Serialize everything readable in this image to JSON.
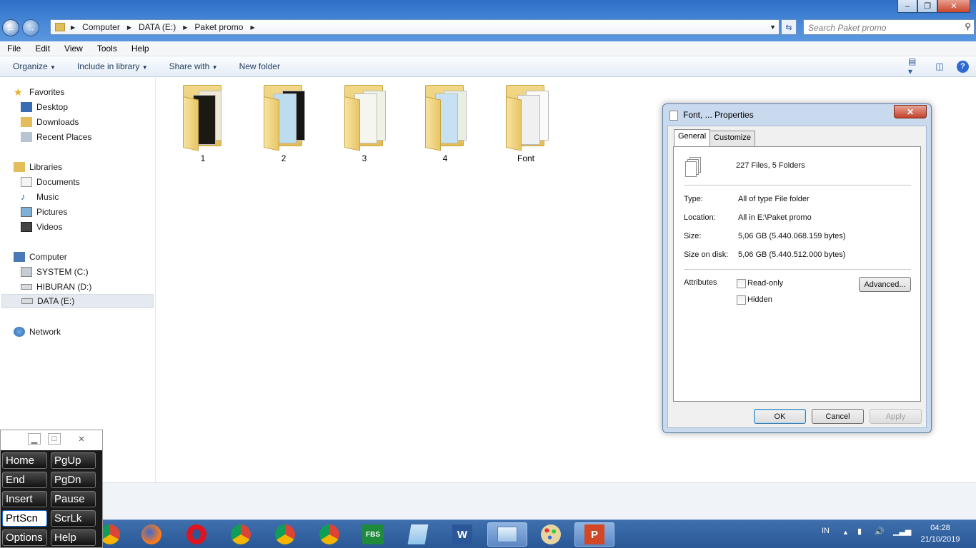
{
  "window": {
    "address": {
      "crumbs": [
        "Computer",
        "DATA (E:)",
        "Paket promo"
      ]
    },
    "search_placeholder": "Search Paket promo",
    "controls": {
      "minimize": "‒",
      "maximize": "❐",
      "close": "✕"
    }
  },
  "menu": [
    "File",
    "Edit",
    "View",
    "Tools",
    "Help"
  ],
  "toolbar": {
    "organize": "Organize",
    "include": "Include in library",
    "share": "Share with",
    "new_folder": "New folder"
  },
  "nav": {
    "favorites": "Favorites",
    "desktop": "Desktop",
    "downloads": "Downloads",
    "recent": "Recent Places",
    "libraries": "Libraries",
    "documents": "Documents",
    "music": "Music",
    "pictures": "Pictures",
    "videos": "Videos",
    "computer": "Computer",
    "system_c": "SYSTEM (C:)",
    "hiburan_d": "HIBURAN (D:)",
    "data_e": "DATA (E:)",
    "network": "Network"
  },
  "folders": [
    "1",
    "2",
    "3",
    "4",
    "Font"
  ],
  "dialog": {
    "title": "Font, ... Properties",
    "close": "✕",
    "tabs": {
      "general": "General",
      "customize": "Customize"
    },
    "summary": "227 Files, 5 Folders",
    "type_label": "Type:",
    "type_value": "All of type File folder",
    "location_label": "Location:",
    "location_value": "All in E:\\Paket promo",
    "size_label": "Size:",
    "size_value": "5,06 GB (5.440.068.159 bytes)",
    "disk_label": "Size on disk:",
    "disk_value": "5,06 GB (5.440.512.000 bytes)",
    "attributes_label": "Attributes",
    "readonly": "Read-only",
    "hidden": "Hidden",
    "advanced": "Advanced...",
    "ok": "OK",
    "cancel": "Cancel",
    "apply": "Apply"
  },
  "osk": {
    "keys": [
      "Home",
      "PgUp",
      "End",
      "PgDn",
      "Insert",
      "Pause",
      "PrtScn",
      "ScrLk",
      "Options",
      "Help"
    ]
  },
  "tray": {
    "lang": "IN",
    "time": "04:28",
    "date": "21/10/2019"
  },
  "taskbar": {
    "fbs": "FBS"
  },
  "colors": {
    "accent": "#2f6fc7",
    "taskbar": "#2a5896"
  }
}
